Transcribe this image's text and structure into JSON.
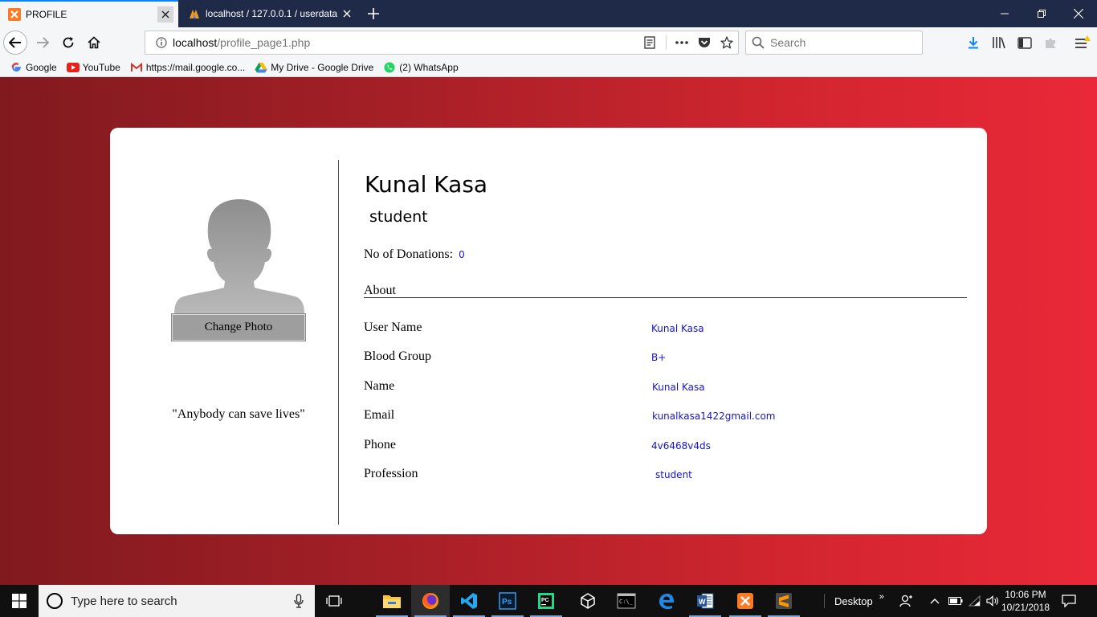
{
  "browser": {
    "tabs": [
      {
        "title": "PROFILE",
        "active": true
      },
      {
        "title": "localhost / 127.0.0.1 / userdata",
        "active": false
      }
    ],
    "url": {
      "host": "localhost",
      "path": "/profile_page1.php"
    },
    "search_placeholder": "Search",
    "bookmarks": [
      {
        "label": "Google",
        "icon": "google-icon"
      },
      {
        "label": "YouTube",
        "icon": "youtube-icon"
      },
      {
        "label": "https://mail.google.co...",
        "icon": "gmail-icon"
      },
      {
        "label": "My Drive - Google Drive",
        "icon": "google-drive-icon"
      },
      {
        "label": "(2) WhatsApp",
        "icon": "whatsapp-icon"
      }
    ]
  },
  "profile": {
    "name": "Kunal Kasa",
    "role": "student",
    "donations_label": "No of Donations:",
    "donations_value": "0",
    "change_photo_label": "Change Photo",
    "quote": "\"Anybody can save lives\"",
    "about_heading": "About",
    "details": [
      {
        "label": "User Name",
        "value": "Kunal Kasa"
      },
      {
        "label": "Blood Group",
        "value": "B+"
      },
      {
        "label": "Name",
        "value": "Kunal Kasa"
      },
      {
        "label": "Email",
        "value": "kunalkasa1422gmail.com"
      },
      {
        "label": "Phone",
        "value": "4v6468v4ds"
      },
      {
        "label": "Profession",
        "value": "student"
      }
    ]
  },
  "taskbar": {
    "search_placeholder": "Type here to search",
    "desktop_label": "Desktop",
    "time": "10:06 PM",
    "date": "10/21/2018"
  },
  "colors": {
    "gradient_start": "#801a1f",
    "gradient_end": "#ea2838",
    "value_text": "#1414c8",
    "tab_strip": "#1e2a47"
  }
}
